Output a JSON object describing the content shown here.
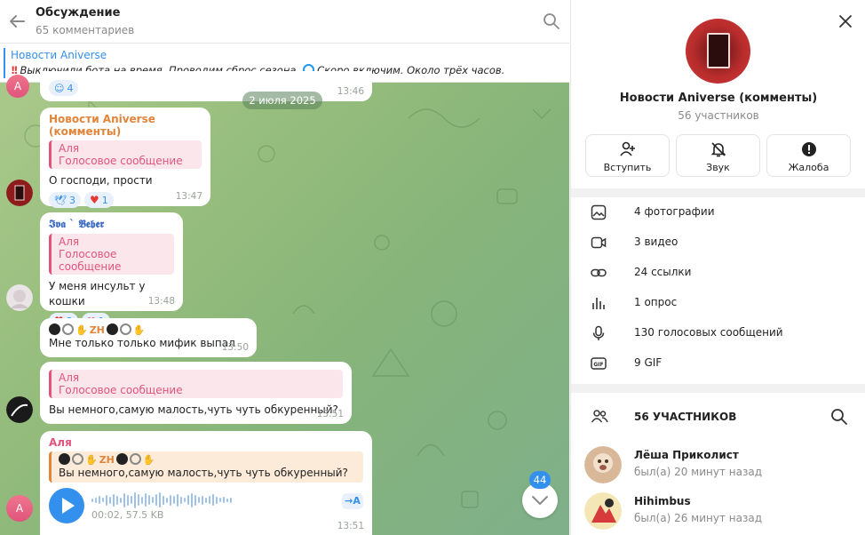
{
  "header": {
    "title": "Обсуждение",
    "subtitle": "65 комментариев"
  },
  "pinned": {
    "title": "Новости Aniverse",
    "exclaim": "!!",
    "text_part1": "Выключили бота на время. Проводим сброс сезона.",
    "text_part2": "Скоро включим. Около трёх часов."
  },
  "chat": {
    "date_divider": "2 июля 2025",
    "top_partial": {
      "reaction_count": "4",
      "time": "13:46"
    },
    "messages": [
      {
        "author": "Новости Aniverse (комменты)",
        "reply_author": "Аля",
        "reply_text": "Голосовое сообщение",
        "text": "О господи, прости",
        "reactions": [
          {
            "emoji": "🕊",
            "count": "3"
          },
          {
            "emoji": "♥",
            "count": "1"
          }
        ],
        "time": "13:47"
      },
      {
        "author": "𝕴𝖛𝖆 ` 𝕭𝖊𝖇𝖊𝖗",
        "reply_author": "Аля",
        "reply_text": "Голосовое сообщение",
        "text": "У меня инсульт у кошки",
        "reactions": [
          {
            "emoji": "♥",
            "count": "3"
          },
          {
            "emoji": "❤",
            "count": "1"
          }
        ],
        "time": "13:48"
      },
      {
        "emoji_name": "ZH",
        "text": "Мне только только мифик выпал",
        "time": "13:50"
      },
      {
        "reply_author": "Аля",
        "reply_text": "Голосовое сообщение",
        "text": "Вы немного,самую малость,чуть чуть обкуренный?",
        "time": "13:51"
      },
      {
        "author": "Аля",
        "reply_emoji_name": "ZH",
        "reply_text": "Вы немного,самую малость,чуть чуть обкуренный?",
        "audio_meta": "00:02, 57.5 KB",
        "transcribe_label": "→A",
        "time": "13:51"
      }
    ],
    "avatar_letter": "A",
    "unread_count": "44"
  },
  "panel": {
    "group_name": "Новости Aniverse (комменты)",
    "group_members": "56 участников",
    "actions": [
      {
        "label": "Вступить",
        "icon": "join-icon"
      },
      {
        "label": "Звук",
        "icon": "bell-off-icon"
      },
      {
        "label": "Жалоба",
        "icon": "report-icon"
      }
    ],
    "media": [
      {
        "label": "4 фотографии",
        "icon": "photo-icon"
      },
      {
        "label": "3 видео",
        "icon": "video-icon"
      },
      {
        "label": "24 ссылки",
        "icon": "link-icon"
      },
      {
        "label": "1 опрос",
        "icon": "poll-icon"
      },
      {
        "label": "130 голосовых сообщений",
        "icon": "mic-icon"
      },
      {
        "label": "9 GIF",
        "icon": "gif-icon"
      }
    ],
    "members_title": "56 УЧАСТНИКОВ",
    "members": [
      {
        "name": "Лёша Приколист",
        "status": "был(а) 20 минут назад"
      },
      {
        "name": "Hihimbus",
        "status": "был(а) 26 минут назад"
      }
    ]
  },
  "colors": {
    "accent": "#3390ec",
    "reply_pink": "#e0557c",
    "author_orange": "#e0853a",
    "author_blue": "#3c6bc4"
  }
}
